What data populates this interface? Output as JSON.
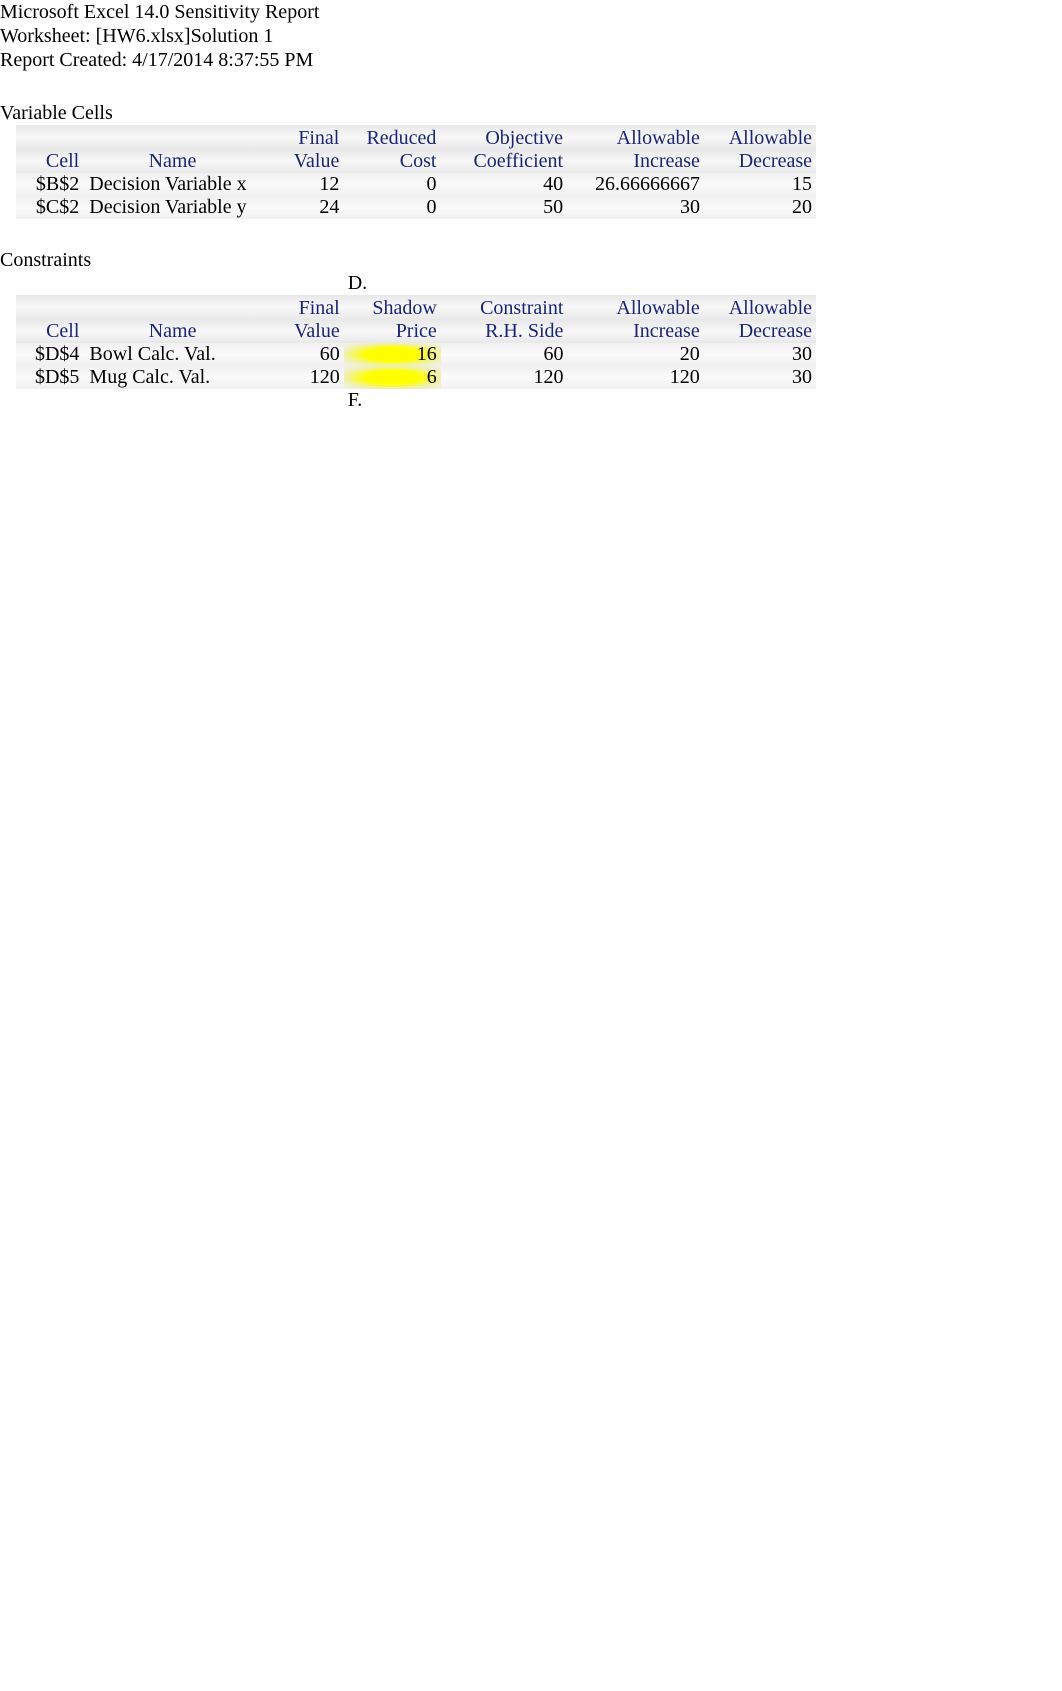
{
  "header": {
    "line1": "Microsoft Excel 14.0 Sensitivity Report",
    "line2": "Worksheet: [HW6.xlsx]Solution 1",
    "line3": "Report Created: 4/17/2014 8:37:55 PM"
  },
  "varcells": {
    "title": "Variable Cells",
    "head1": {
      "c1": "",
      "c2": "",
      "c3": "Final",
      "c4": "Reduced",
      "c5": "Objective",
      "c6": "Allowable",
      "c7": "Allowable"
    },
    "head2": {
      "c1": "Cell",
      "c2": "Name",
      "c3": "Value",
      "c4": "Cost",
      "c5": "Coefficient",
      "c6": "Increase",
      "c7": "Decrease"
    },
    "rows": [
      {
        "cell": "$B$2",
        "name": "Decision Variable x",
        "final": "12",
        "reduced": "0",
        "obj": "40",
        "inc": "26.66666667",
        "dec": "15"
      },
      {
        "cell": "$C$2",
        "name": "Decision Variable y",
        "final": "24",
        "reduced": "0",
        "obj": "50",
        "inc": "30",
        "dec": "20"
      }
    ]
  },
  "constraints": {
    "title": "Constraints",
    "annot_top": "D.",
    "annot_bottom": "F.",
    "head1": {
      "c1": "",
      "c2": "",
      "c3": "Final",
      "c4": "Shadow",
      "c5": "Constraint",
      "c6": "Allowable",
      "c7": "Allowable"
    },
    "head2": {
      "c1": "Cell",
      "c2": "Name",
      "c3": "Value",
      "c4": "Price",
      "c5": "R.H. Side",
      "c6": "Increase",
      "c7": "Decrease"
    },
    "rows": [
      {
        "cell": "$D$4",
        "name": "Bowl Calc. Val.",
        "final": "60",
        "shadow": "16",
        "rhs": "60",
        "inc": "20",
        "dec": "30"
      },
      {
        "cell": "$D$5",
        "name": "Mug Calc. Val.",
        "final": "120",
        "shadow": "6",
        "rhs": "120",
        "inc": "120",
        "dec": "30"
      }
    ]
  }
}
